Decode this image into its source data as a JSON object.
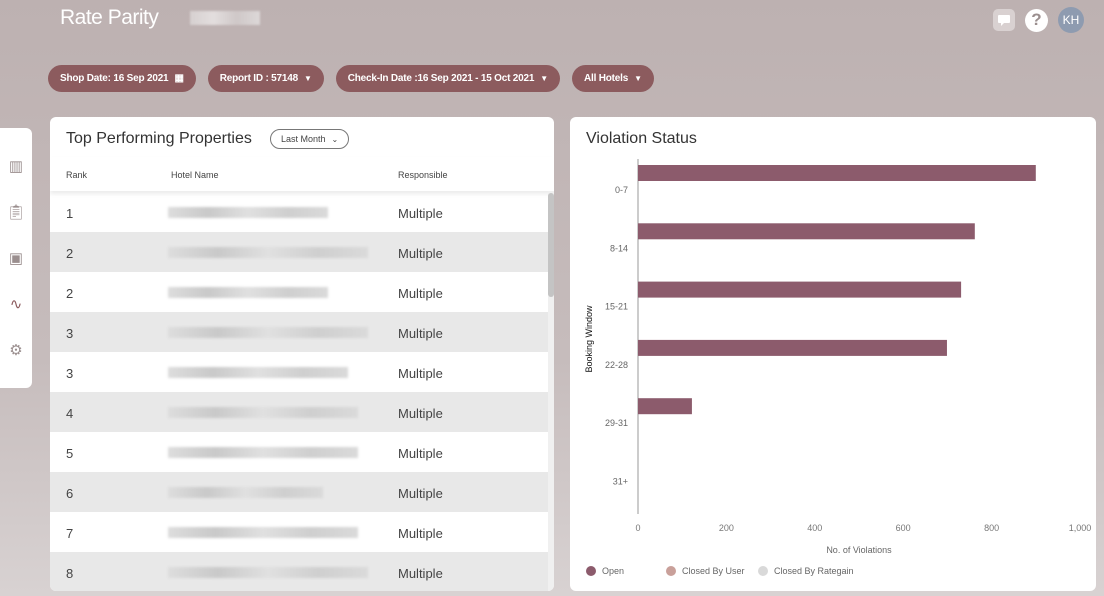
{
  "header": {
    "title": "Rate Parity",
    "avatar": "KH",
    "help": "?"
  },
  "filters": {
    "shop_date": "Shop Date: 16 Sep 2021",
    "report_id": "Report ID : 57148",
    "checkin": "Check-In Date :16 Sep 2021 - 15 Oct 2021",
    "hotels": "All Hotels"
  },
  "table": {
    "title": "Top Performing Properties",
    "period": "Last Month",
    "columns": [
      "Rank",
      "Hotel Name",
      "Responsible"
    ],
    "rows": [
      {
        "rank": "1",
        "responsible": "Multiple"
      },
      {
        "rank": "2",
        "responsible": "Multiple"
      },
      {
        "rank": "2",
        "responsible": "Multiple"
      },
      {
        "rank": "3",
        "responsible": "Multiple"
      },
      {
        "rank": "3",
        "responsible": "Multiple"
      },
      {
        "rank": "4",
        "responsible": "Multiple"
      },
      {
        "rank": "5",
        "responsible": "Multiple"
      },
      {
        "rank": "6",
        "responsible": "Multiple"
      },
      {
        "rank": "7",
        "responsible": "Multiple"
      },
      {
        "rank": "8",
        "responsible": "Multiple"
      }
    ]
  },
  "chart_data": {
    "type": "bar",
    "orientation": "horizontal",
    "title": "Violation Status",
    "categories": [
      "0-7",
      "8-14",
      "15-21",
      "22-28",
      "29-31",
      "31+"
    ],
    "series": [
      {
        "name": "Open",
        "color": "#8c5b6c",
        "values": [
          900,
          762,
          731,
          699,
          122,
          0
        ]
      },
      {
        "name": "Closed By User",
        "color": "#c9a09a",
        "values": [
          0,
          0,
          0,
          0,
          0,
          0
        ]
      },
      {
        "name": "Closed By Rategain",
        "color": "#d9d9d9",
        "values": [
          0,
          0,
          0,
          0,
          0,
          0
        ]
      }
    ],
    "xlabel": "No. of Violations",
    "ylabel": "Booking Window",
    "xlim": [
      0,
      1000
    ],
    "xticks": [
      "0",
      "200",
      "400",
      "600",
      "800",
      "1,000"
    ],
    "legend": "bottom-left"
  }
}
